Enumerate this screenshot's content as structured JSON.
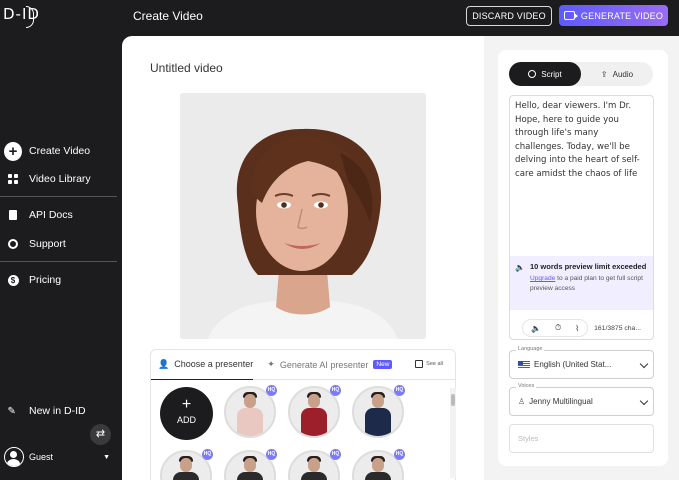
{
  "app": {
    "logo": "D-ID",
    "page_title": "Create Video"
  },
  "header": {
    "discard_label": "DISCARD VIDEO",
    "generate_label": "GENERATE VIDEO"
  },
  "sidebar": {
    "items": [
      {
        "label": "Create Video",
        "icon": "plus-circle-icon"
      },
      {
        "label": "Video Library",
        "icon": "grid-icon"
      },
      {
        "label": "API Docs",
        "icon": "document-icon"
      },
      {
        "label": "Support",
        "icon": "support-icon"
      },
      {
        "label": "Pricing",
        "icon": "dollar-icon"
      },
      {
        "label": "New in D-ID",
        "icon": "megaphone-icon"
      }
    ],
    "user": {
      "name": "Guest"
    }
  },
  "main": {
    "video_title": "Untitled video",
    "presenter_tabs": [
      {
        "label": "Choose a presenter",
        "active": true
      },
      {
        "label": "Generate AI presenter",
        "badge": "New",
        "active": false
      }
    ],
    "see_all_label": "See all",
    "add_label": "ADD",
    "hq_badge": "HQ"
  },
  "right": {
    "tabs": [
      {
        "label": "Script",
        "active": true
      },
      {
        "label": "Audio",
        "active": false
      }
    ],
    "script_text": "Hello, dear viewers. I'm Dr. Hope, here to guide you through life's many challenges. Today, we'll be delving into the heart of self-care amidst the chaos of life",
    "limit": {
      "title": "10 words preview limit exceeded",
      "link_text": "Upgrade",
      "desc_rest": " to a paid plan to get full script preview access"
    },
    "char_count": "161/3875 cha...",
    "language": {
      "label": "Language",
      "value": "English (United Stat..."
    },
    "voices": {
      "label": "Voices",
      "value": "Jenny Multilingual"
    },
    "styles_placeholder": "Styles"
  },
  "colors": {
    "accent": "#5d5bff",
    "accent_gradient_end": "#9a6cf2",
    "sidebar_bg": "#1c1c1e"
  }
}
